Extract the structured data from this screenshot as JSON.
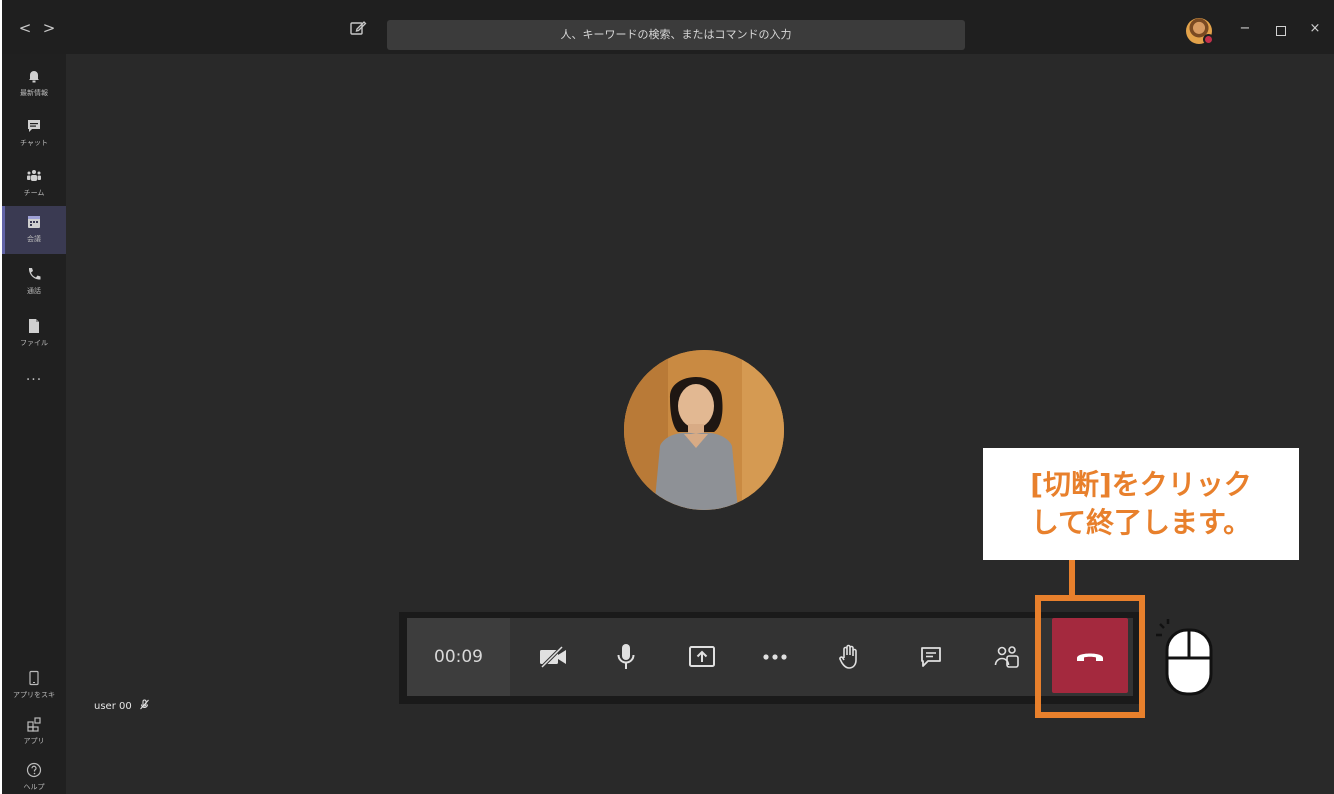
{
  "titlebar": {
    "back_glyph": "<",
    "forward_glyph": ">",
    "search_placeholder": "人、キーワードの検索、またはコマンドの入力",
    "minimize_glyph": "−",
    "close_glyph": "×",
    "presence_color": "#c4314b"
  },
  "rail": {
    "items": [
      {
        "label": "最新情報",
        "icon": "bell-icon"
      },
      {
        "label": "チャット",
        "icon": "chat-icon"
      },
      {
        "label": "チーム",
        "icon": "teams-icon"
      },
      {
        "label": "会議",
        "icon": "calendar-icon",
        "active": true
      },
      {
        "label": "通話",
        "icon": "phone-icon"
      },
      {
        "label": "ファイル",
        "icon": "file-icon"
      }
    ],
    "more": "···",
    "bottom_items": [
      {
        "label": "アプリをスキ",
        "icon": "device-icon"
      },
      {
        "label": "アプリ",
        "icon": "apps-icon"
      },
      {
        "label": "ヘルプ",
        "icon": "help-icon"
      }
    ]
  },
  "call": {
    "self_name": "user 00",
    "timer": "00:09",
    "controls": [
      "camera-off-icon",
      "microphone-icon",
      "share-screen-icon",
      "more-options-icon",
      "raise-hand-icon",
      "chat-icon",
      "participants-icon",
      "hang-up-icon"
    ],
    "hangup_color": "#a4293e"
  },
  "annotation": {
    "line1": "[切断]をクリック",
    "line2": "して終了します。",
    "accent_color": "#e8802c"
  }
}
